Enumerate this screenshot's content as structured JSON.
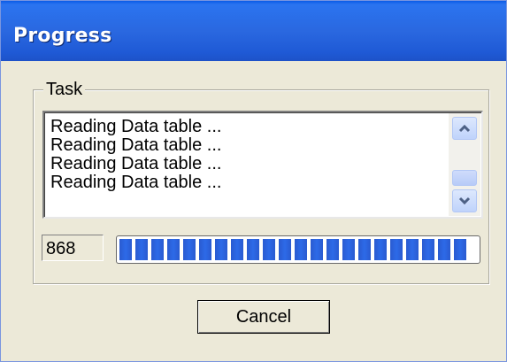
{
  "window": {
    "title": "Progress"
  },
  "task_group": {
    "label": "Task",
    "log_lines": [
      "Reading Data table ...",
      "Reading Data table ...",
      "Reading Data table ...",
      "Reading Data table ..."
    ]
  },
  "status": {
    "count": "868",
    "progress_fraction": 0.99
  },
  "buttons": {
    "cancel_label": "Cancel"
  },
  "icons": {
    "scroll_up": "chevron-up-icon",
    "scroll_down": "chevron-down-icon"
  },
  "colors": {
    "titlebar": "#2a68e0",
    "progress_chunk": "#2d6ae8",
    "window_bg": "#ece9d8"
  }
}
